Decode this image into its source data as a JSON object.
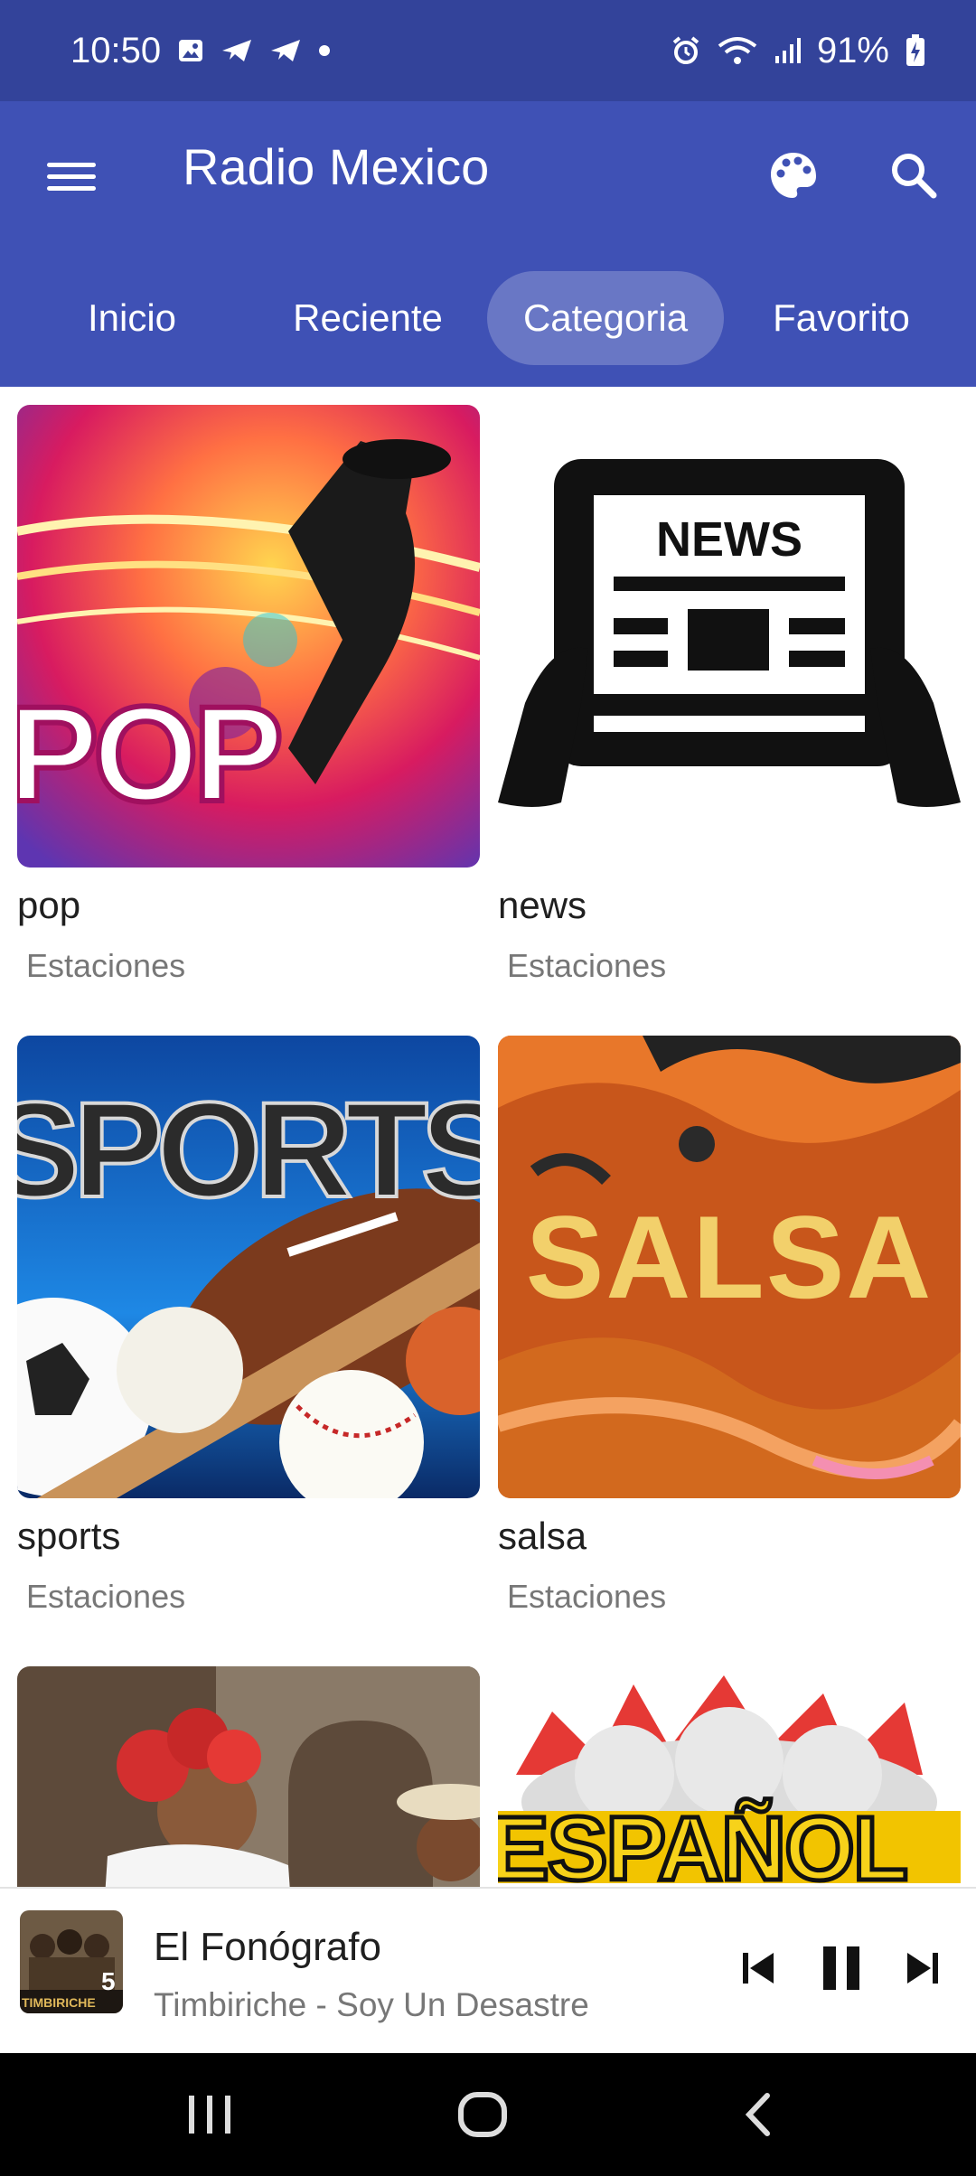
{
  "status": {
    "time": "10:50",
    "battery": "91%"
  },
  "appbar": {
    "title": "Radio Mexico",
    "menu_icon": "hamburger-menu-icon",
    "palette_icon": "palette-icon",
    "search_icon": "search-icon"
  },
  "tabs": [
    {
      "label": "Inicio"
    },
    {
      "label": "Reciente"
    },
    {
      "label": "Categoria",
      "active": true
    },
    {
      "label": "Favorito"
    }
  ],
  "categories": [
    {
      "name": "pop",
      "sub": "Estaciones",
      "art_text": "POP"
    },
    {
      "name": "news",
      "sub": "Estaciones",
      "art_text": "NEWS"
    },
    {
      "name": "sports",
      "sub": "Estaciones",
      "art_text": "SPORTS"
    },
    {
      "name": "salsa",
      "sub": "Estaciones",
      "art_text": "SALSA"
    },
    {
      "name": "",
      "sub": "",
      "art_text": ""
    },
    {
      "name": "",
      "sub": "",
      "art_text": "ESPAÑOL"
    }
  ],
  "player": {
    "title": "El Fonógrafo",
    "subtitle": "Timbiriche - Soy Un Desastre",
    "art_text": "TIMBIRICHE",
    "prev_icon": "skip-previous-icon",
    "pause_icon": "pause-icon",
    "next_icon": "skip-next-icon"
  },
  "colors": {
    "status_bar": "#33439a",
    "app_bar": "#3f51b5"
  }
}
